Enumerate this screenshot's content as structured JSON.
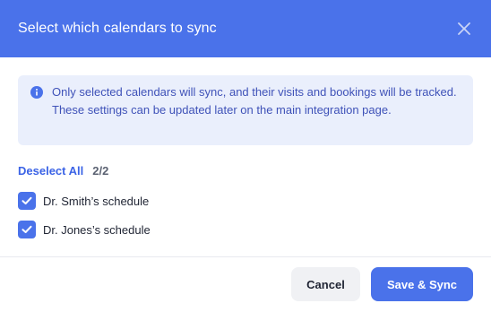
{
  "dialog": {
    "title": "Select which calendars to sync",
    "close_icon": "close-icon"
  },
  "info": {
    "icon": "info-icon",
    "text": "Only selected calendars will sync, and their visits and bookings will be tracked. These settings can be updated later on the main integration page."
  },
  "selection": {
    "deselect_label": "Deselect All",
    "count": "2/2"
  },
  "calendars": [
    {
      "label": "Dr. Smith’s schedule",
      "checked": true
    },
    {
      "label": "Dr. Jones’s schedule",
      "checked": true
    }
  ],
  "footer": {
    "cancel_label": "Cancel",
    "save_label": "Save & Sync"
  },
  "colors": {
    "primary": "#4a72ea",
    "info_bg": "#eaeffc",
    "info_text": "#3f52b8",
    "link": "#3b63e6"
  }
}
